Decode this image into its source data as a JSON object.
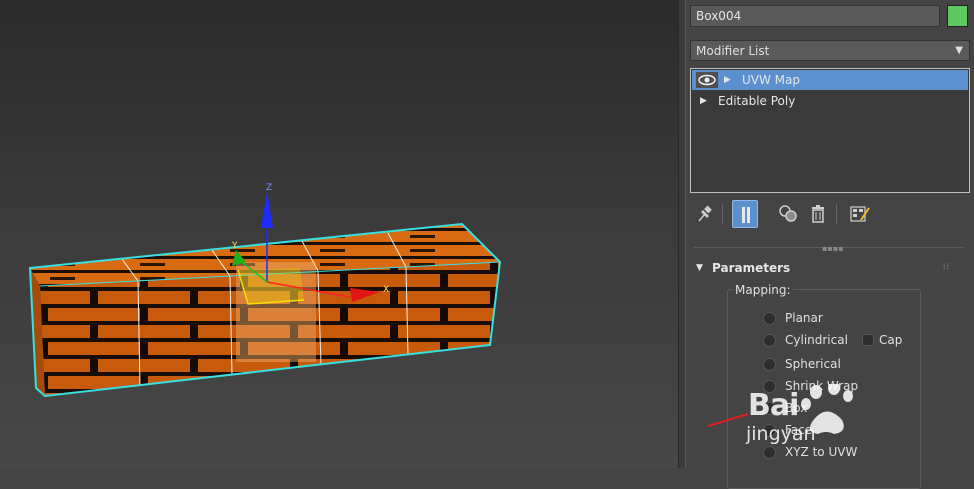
{
  "viewport": {
    "axis_z_label": "Z",
    "axis_x_label": "X",
    "axis_y_label": "Y"
  },
  "object": {
    "name": "Box004",
    "color": "#5ec95e"
  },
  "modifier_list": {
    "label": "Modifier List"
  },
  "stack": {
    "items": [
      {
        "label": "UVW Map",
        "selected": true
      },
      {
        "label": "Editable Poly",
        "selected": false
      }
    ]
  },
  "toolbar": {
    "icons": [
      "pin-stack-icon",
      "show-end-result-icon",
      "make-unique-icon",
      "remove-modifier-icon",
      "configure-modifier-sets-icon"
    ]
  },
  "parameters": {
    "title": "Parameters",
    "mapping_label": "Mapping:",
    "options": [
      "Planar",
      "Cylindrical",
      "Spherical",
      "Shrink Wrap",
      "Box",
      "Face",
      "XYZ to UVW"
    ],
    "cap_label": "Cap"
  },
  "watermark": {
    "line1": "Bai",
    "line2": "jingyan"
  },
  "colors": {
    "accent_selected": "#5b8fd0",
    "selection_outline": "#38e0e0",
    "brick": "#d9640f"
  }
}
